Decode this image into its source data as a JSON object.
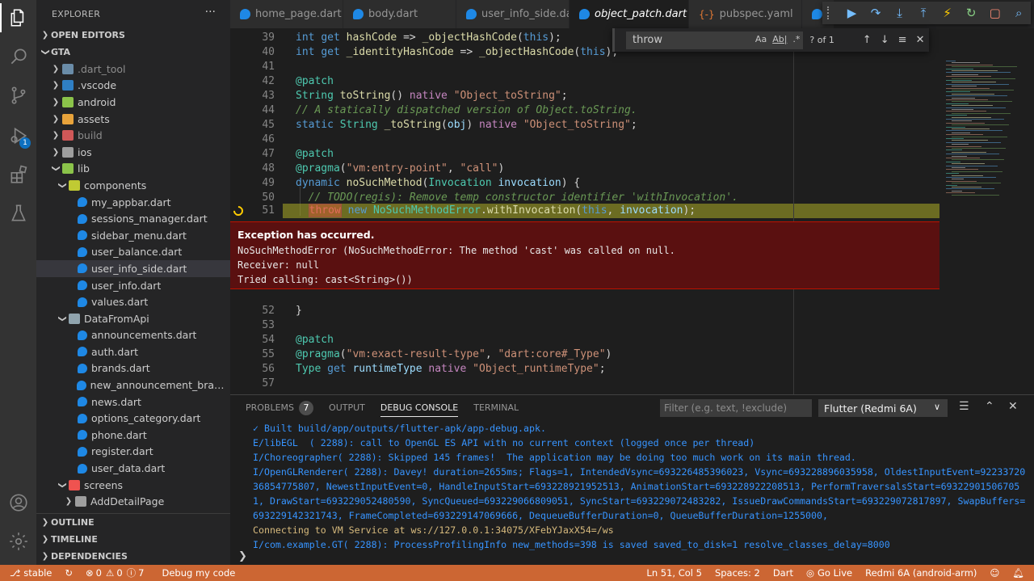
{
  "explorer": {
    "title": "EXPLORER",
    "more": "···",
    "open_editors": "OPEN EDITORS",
    "project": "GTA",
    "tree": [
      {
        "label": ".dart_tool",
        "type": "folder",
        "depth": 1,
        "collapsed": true,
        "dim": true,
        "color": "#6a8ca8"
      },
      {
        "label": ".vscode",
        "type": "folder",
        "depth": 1,
        "collapsed": true,
        "dim": false,
        "color": "#2f7fc4"
      },
      {
        "label": "android",
        "type": "folder",
        "depth": 1,
        "collapsed": true,
        "dim": false,
        "color": "#8bc34a"
      },
      {
        "label": "assets",
        "type": "folder",
        "depth": 1,
        "collapsed": true,
        "dim": false,
        "color": "#e8a33b"
      },
      {
        "label": "build",
        "type": "folder",
        "depth": 1,
        "collapsed": true,
        "dim": true,
        "color": "#d05858"
      },
      {
        "label": "ios",
        "type": "folder",
        "depth": 1,
        "collapsed": true,
        "dim": false,
        "color": "#9e9e9e"
      },
      {
        "label": "lib",
        "type": "folder",
        "depth": 1,
        "collapsed": false,
        "dim": false,
        "color": "#8bc34a"
      },
      {
        "label": "components",
        "type": "folder",
        "depth": 2,
        "collapsed": false,
        "dim": false,
        "color": "#c0ca33"
      },
      {
        "label": "my_appbar.dart",
        "type": "dart",
        "depth": 3
      },
      {
        "label": "sessions_manager.dart",
        "type": "dart",
        "depth": 3
      },
      {
        "label": "sidebar_menu.dart",
        "type": "dart",
        "depth": 3
      },
      {
        "label": "user_balance.dart",
        "type": "dart",
        "depth": 3
      },
      {
        "label": "user_info_side.dart",
        "type": "dart",
        "depth": 3,
        "selected": true
      },
      {
        "label": "user_info.dart",
        "type": "dart",
        "depth": 3
      },
      {
        "label": "values.dart",
        "type": "dart",
        "depth": 3
      },
      {
        "label": "DataFromApi",
        "type": "folder",
        "depth": 2,
        "collapsed": false,
        "dim": false,
        "color": "#90a4ae"
      },
      {
        "label": "announcements.dart",
        "type": "dart",
        "depth": 3
      },
      {
        "label": "auth.dart",
        "type": "dart",
        "depth": 3
      },
      {
        "label": "brands.dart",
        "type": "dart",
        "depth": 3
      },
      {
        "label": "new_announcement_brads.d...",
        "type": "dart",
        "depth": 3
      },
      {
        "label": "news.dart",
        "type": "dart",
        "depth": 3
      },
      {
        "label": "options_category.dart",
        "type": "dart",
        "depth": 3
      },
      {
        "label": "phone.dart",
        "type": "dart",
        "depth": 3
      },
      {
        "label": "register.dart",
        "type": "dart",
        "depth": 3
      },
      {
        "label": "user_data.dart",
        "type": "dart",
        "depth": 3
      },
      {
        "label": "screens",
        "type": "folder",
        "depth": 2,
        "collapsed": false,
        "dim": false,
        "color": "#ef5350"
      },
      {
        "label": "AddDetailPage",
        "type": "folder",
        "depth": 3,
        "collapsed": true,
        "dim": false,
        "color": "#9e9e9e"
      }
    ],
    "outline": "OUTLINE",
    "timeline": "TIMELINE",
    "dependencies": "DEPENDENCIES"
  },
  "activity": {
    "debug_badge": "1"
  },
  "tabs": [
    {
      "label": "home_page.dart",
      "kind": "dart"
    },
    {
      "label": "body.dart",
      "kind": "dart"
    },
    {
      "label": "user_info_side.dart",
      "kind": "dart"
    },
    {
      "label": "object_patch.dart",
      "kind": "dart",
      "active": true
    },
    {
      "label": "pubspec.yaml",
      "kind": "yaml"
    }
  ],
  "find": {
    "value": "throw",
    "opt_case": "Aa",
    "opt_word": "Ab|",
    "opt_regex": ".*",
    "count": "? of 1"
  },
  "editor": {
    "lines": [
      {
        "n": "39",
        "html": "<span class='kw'>int</span> <span class='kw'>get</span> <span class='fn'>hashCode</span> <span class='plain'>=&gt;</span> <span class='fn'>_objectHashCode</span><span class='plain'>(</span><span class='kw'>this</span><span class='plain'>);</span>"
      },
      {
        "n": "40",
        "html": "<span class='kw'>int</span> <span class='kw'>get</span> <span class='fn'>_identityHashCode</span> <span class='plain'>=&gt;</span> <span class='fn'>_objectHashCode</span><span class='plain'>(</span><span class='kw'>this</span><span class='plain'>);</span>"
      },
      {
        "n": "41",
        "html": ""
      },
      {
        "n": "42",
        "html": "<span class='ann'>@patch</span>"
      },
      {
        "n": "43",
        "html": "<span class='ty'>String</span> <span class='fn'>toString</span><span class='plain'>()</span> <span class='ctl'>native</span> <span class='str'>\"Object_toString\"</span><span class='plain'>;</span>"
      },
      {
        "n": "44",
        "html": "<span class='cmt'>// A statically dispatched version of Object.toString.</span>"
      },
      {
        "n": "45",
        "html": "<span class='kw'>static</span> <span class='ty'>String</span> <span class='fn'>_toString</span><span class='plain'>(</span><span class='var'>obj</span><span class='plain'>)</span> <span class='ctl'>native</span> <span class='str'>\"Object_toString\"</span><span class='plain'>;</span>"
      },
      {
        "n": "46",
        "html": ""
      },
      {
        "n": "47",
        "html": "<span class='ann'>@patch</span>"
      },
      {
        "n": "48",
        "html": "<span class='ann'>@pragma</span><span class='plain'>(</span><span class='str'>\"vm:entry-point\"</span><span class='plain'>,</span> <span class='str'>\"call\"</span><span class='plain'>)</span>"
      },
      {
        "n": "49",
        "html": "<span class='kw'>dynamic</span> <span class='fn'>noSuchMethod</span><span class='plain'>(</span><span class='ty'>Invocation</span> <span class='var'>invocation</span><span class='plain'>) {</span>"
      },
      {
        "n": "50",
        "html": "  <span class='cmt'>// TODO(regis): Remove temp constructor identifier 'withInvocation'.</span>"
      },
      {
        "n": "51",
        "html": "  <span class='throwbox'>throw</span> <span class='kw'>new</span> <span class='ty'>NoSuchMethodError</span><span class='plain'>.</span><span class='fn'>withInvocation</span><span class='plain'>(</span><span class='kw'>this</span><span class='plain'>,</span> <span class='var'>invocation</span><span class='plain'>);</span>",
        "highlight": true,
        "breakpoint": true
      },
      {
        "n": "52",
        "html": "<span class='plain'>}</span>"
      },
      {
        "n": "53",
        "html": ""
      },
      {
        "n": "54",
        "html": "<span class='ann'>@patch</span>"
      },
      {
        "n": "55",
        "html": "<span class='ann'>@pragma</span><span class='plain'>(</span><span class='str'>\"vm:exact-result-type\"</span><span class='plain'>,</span> <span class='str'>\"dart:core#_Type\"</span><span class='plain'>)</span>"
      },
      {
        "n": "56",
        "html": "<span class='ty'>Type</span> <span class='kw'>get</span> <span class='var'>runtimeType</span> <span class='ctl'>native</span> <span class='str'>\"Object_runtimeType\"</span><span class='plain'>;</span>"
      },
      {
        "n": "57",
        "html": ""
      }
    ]
  },
  "exception": {
    "title": "Exception has occurred.",
    "lines": [
      "NoSuchMethodError (NoSuchMethodError: The method 'cast' was called on null.",
      "Receiver: null",
      "Tried calling: cast<String>())"
    ]
  },
  "panel": {
    "tabs": [
      {
        "label": "PROBLEMS",
        "count": "7"
      },
      {
        "label": "OUTPUT"
      },
      {
        "label": "DEBUG CONSOLE",
        "active": true
      },
      {
        "label": "TERMINAL"
      }
    ],
    "filter_placeholder": "Filter (e.g. text, !exclude)",
    "device": "Flutter (Redmi 6A)",
    "console": [
      {
        "text": "✓ Built build/app/outputs/flutter-apk/app-debug.apk.",
        "style": "blue"
      },
      {
        "text": "E/libEGL  ( 2288): call to OpenGL ES API with no current context (logged once per thread)",
        "style": "blue"
      },
      {
        "text": "I/Choreographer( 2288): Skipped 145 frames!  The application may be doing too much work on its main thread.",
        "style": "blue"
      },
      {
        "text": "I/OpenGLRenderer( 2288): Davey! duration=2655ms; Flags=1, IntendedVsync=693226485396023, Vsync=693228896035958, OldestInputEvent=9223372036854775807, NewestInputEvent=0, HandleInputStart=693228921952513, AnimationStart=693228922208513, PerformTraversalsStart=693229015067051, DrawStart=693229052480590, SyncQueued=693229066809051, SyncStart=693229072483282, IssueDrawCommandsStart=693229072817897, SwapBuffers=693229142321743, FrameCompleted=693229147069666, DequeueBufferDuration=0, QueueBufferDuration=1255000,",
        "style": "blue"
      },
      {
        "text": "Connecting to VM Service at ws://127.0.0.1:34075/XFebYJaxX54=/ws",
        "style": "yellow"
      },
      {
        "text": "I/com.example.GT( 2288): ProcessProfilingInfo new_methods=398 is saved saved_to_disk=1 resolve_classes_delay=8000",
        "style": "blue"
      }
    ],
    "prompt": "❯"
  },
  "status": {
    "branch": "stable",
    "errors": "0",
    "warnings": "0",
    "infos": "7",
    "debug": "Debug my code",
    "position": "Ln 51, Col 5",
    "spaces": "Spaces: 2",
    "language": "Dart",
    "golive": "Go Live",
    "device": "Redmi 6A (android-arm)"
  },
  "colors": {
    "status_bar": "#cc6633",
    "exception_bg": "#5a1010",
    "highlight_line": "#8a8a26"
  }
}
